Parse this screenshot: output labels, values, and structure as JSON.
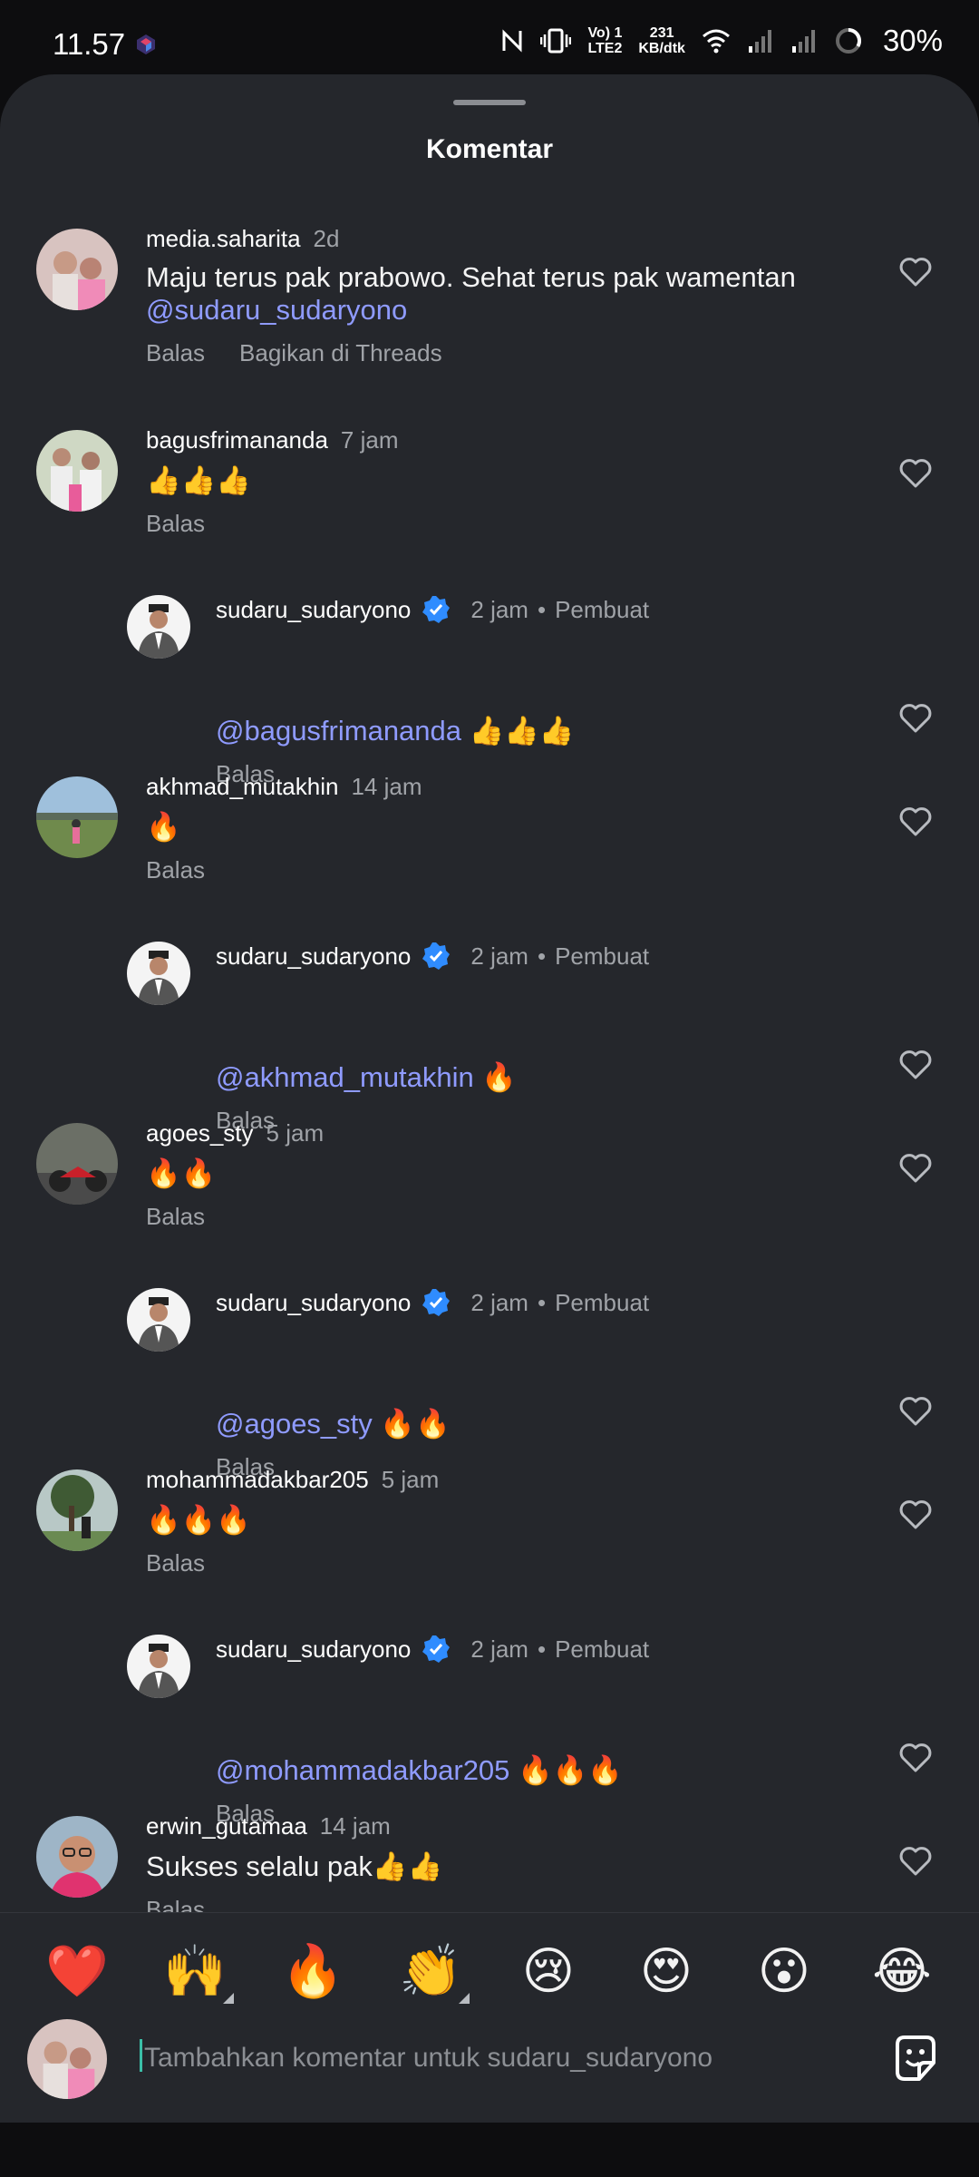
{
  "status_bar": {
    "time": "11.57",
    "speed_value": "231",
    "speed_unit": "KB/dtk",
    "volte_line1": "Vo) 1",
    "volte_line2": "LTE2",
    "battery": "30%",
    "icons": [
      "nfc-icon",
      "vibrate-icon",
      "volte-icon",
      "wifi-icon",
      "signal-icon",
      "signal-icon",
      "battery-ring-icon"
    ]
  },
  "sheet": {
    "title": "Komentar"
  },
  "comments": [
    {
      "username": "media.saharita",
      "time": "2d",
      "text": "Maju terus pak prabowo. Sehat terus pak wamentan",
      "mention": "@sudaru_sudaryono",
      "reply": "Balas",
      "share": "Bagikan di Threads"
    },
    {
      "username": "bagusfrimananda",
      "time": "7 jam",
      "text": "👍👍👍",
      "reply": "Balas"
    },
    {
      "username": "sudaru_sudaryono",
      "time": "2 jam",
      "role": "Pembuat",
      "mention": "@bagusfrimananda",
      "text": " 👍👍👍",
      "reply": "Balas"
    },
    {
      "username": "akhmad_mutakhin",
      "time": "14 jam",
      "text": "🔥",
      "reply": "Balas"
    },
    {
      "username": "sudaru_sudaryono",
      "time": "2 jam",
      "role": "Pembuat",
      "mention": "@akhmad_mutakhin",
      "text": " 🔥",
      "reply": "Balas"
    },
    {
      "username": "agoes_sty",
      "time": "5 jam",
      "text": "🔥🔥",
      "reply": "Balas"
    },
    {
      "username": "sudaru_sudaryono",
      "time": "2 jam",
      "role": "Pembuat",
      "mention": "@agoes_sty",
      "text": " 🔥🔥",
      "reply": "Balas"
    },
    {
      "username": "mohammadakbar205",
      "time": "5 jam",
      "text": "🔥🔥🔥",
      "reply": "Balas"
    },
    {
      "username": "sudaru_sudaryono",
      "time": "2 jam",
      "role": "Pembuat",
      "mention": "@mohammadakbar205",
      "text": " 🔥🔥🔥",
      "reply": "Balas"
    },
    {
      "username": "erwin_gutamaa",
      "time": "14 jam",
      "text": "Sukses selalu pak👍👍",
      "reply": "Balas"
    }
  ],
  "emoji_bar": [
    "❤️",
    "🙌",
    "🔥",
    "👏",
    "😢",
    "😍",
    "😮",
    "😂"
  ],
  "composer": {
    "placeholder": "Tambahkan komentar untuk sudaru_sudaryono",
    "sticker_icon": "sticker-icon"
  },
  "colors": {
    "sheet_bg": "#25272c",
    "mention": "#8f9bff",
    "muted": "#a0a3a8",
    "verified": "#2f8cff"
  }
}
